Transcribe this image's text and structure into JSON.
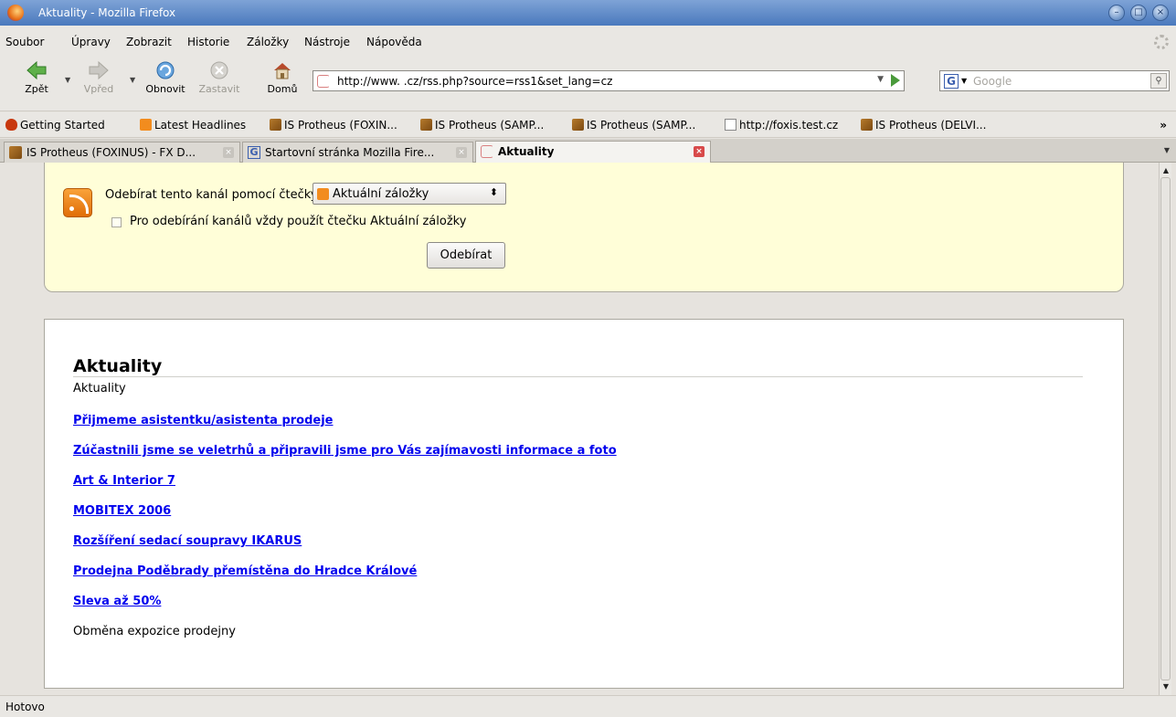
{
  "window": {
    "title": "Aktuality - Mozilla Firefox"
  },
  "menu": {
    "items": [
      {
        "label": "Soubor"
      },
      {
        "label": "Úpravy"
      },
      {
        "label": "Zobrazit"
      },
      {
        "label": "Historie"
      },
      {
        "label": "Záložky"
      },
      {
        "label": "Nástroje"
      },
      {
        "label": "Nápověda"
      }
    ]
  },
  "toolbar": {
    "back_label": "Zpět",
    "forward_label": "Vpřed",
    "reload_label": "Obnovit",
    "stop_label": "Zastavit",
    "home_label": "Domů"
  },
  "urlbar": {
    "value": "http://www.          .cz/rss.php?source=rss1&set_lang=cz"
  },
  "search": {
    "placeholder": "Google"
  },
  "bookmarks": [
    {
      "label": "Getting Started",
      "icon": "firefox-red-icon"
    },
    {
      "label": "Latest Headlines",
      "icon": "rss-icon"
    },
    {
      "label": "IS Protheus (FOXIN...",
      "icon": "package-icon"
    },
    {
      "label": "IS Protheus (SAMP...",
      "icon": "package-icon"
    },
    {
      "label": "IS Protheus (SAMP...",
      "icon": "package-icon"
    },
    {
      "label": "http://foxis.test.cz",
      "icon": "page-icon"
    },
    {
      "label": "IS Protheus (DELVI...",
      "icon": "package-icon"
    }
  ],
  "bookmarks_more": "»",
  "tabs": [
    {
      "label": "IS Protheus (FOXINUS) - FX D...",
      "active": false
    },
    {
      "label": "Startovní stránka Mozilla Fire...",
      "active": false
    },
    {
      "label": "Aktuality",
      "active": true
    }
  ],
  "feed_subscribe": {
    "label": "Odebírat tento kanál pomocí čtečky",
    "reader_value": "Aktuální záložky",
    "always_label": "Pro odebírání kanálů vždy použít čtečku Aktuální záložky",
    "always_checked": false,
    "button_label": "Odebírat"
  },
  "feed": {
    "title": "Aktuality",
    "subtitle": "Aktuality",
    "entries": [
      {
        "title": "Přijmeme asistentku/asistenta prodeje",
        "link": true
      },
      {
        "title": "Zúčastnili jsme se veletrhů a připravili jsme pro Vás zajímavosti informace a foto",
        "link": true
      },
      {
        "title": "Art & Interior 7",
        "link": true
      },
      {
        "title": "MOBITEX 2006",
        "link": true
      },
      {
        "title": "Rozšíření sedací soupravy IKARUS",
        "link": true
      },
      {
        "title": "Prodejna Poděbrady přemístěna do Hradce Králové",
        "link": true
      },
      {
        "title": "Sleva až 50%",
        "link": true
      },
      {
        "title": "Obměna expozice prodejny",
        "link": false
      }
    ]
  },
  "status": {
    "text": "Hotovo"
  },
  "colors": {
    "link": "#0000ee",
    "feed_header_bg": "#fffed8",
    "titlebar": "#4a79bd"
  }
}
